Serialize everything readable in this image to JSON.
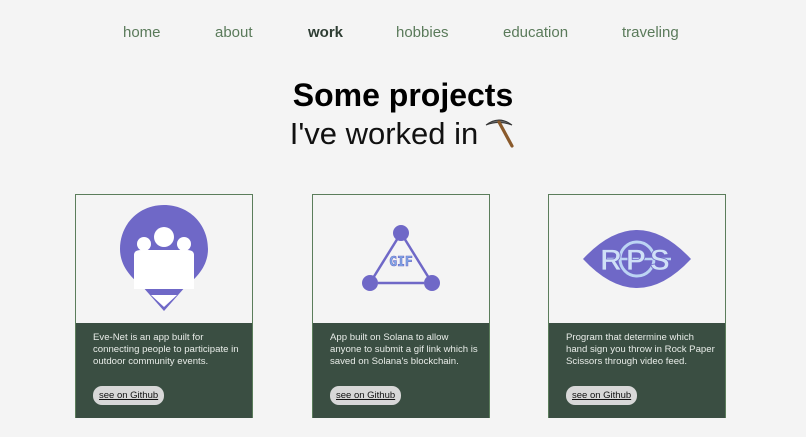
{
  "nav": {
    "items": [
      {
        "label": "home"
      },
      {
        "label": "about"
      },
      {
        "label": "work"
      },
      {
        "label": "hobbies"
      },
      {
        "label": "education"
      },
      {
        "label": "traveling"
      }
    ],
    "active": "work"
  },
  "heading": {
    "title": "Some projects",
    "subtitle": "I've worked in"
  },
  "projects": [
    {
      "name": "Eve-Net",
      "logo_icon": "people-location-pin-icon",
      "description": "Eve-Net is an app built for connecting people to participate in outdoor community events.",
      "button": "see on Github"
    },
    {
      "name": "GIF",
      "logo_icon": "gif-triangle-icon",
      "logo_text": "GIF",
      "description": "App built on Solana to allow anyone to submit a gif link which is saved on Solana's blockchain.",
      "button": "see on Github"
    },
    {
      "name": "RPS",
      "logo_icon": "rps-eye-icon",
      "logo_text": "RPS",
      "description": "Program that determine which hand sign you throw in Rock Paper Scissors through video feed.",
      "button": "see on Github"
    }
  ],
  "colors": {
    "accent": "#5a7a5a",
    "card_body": "#3a4e42",
    "logo_purple": "#6f68c7"
  }
}
